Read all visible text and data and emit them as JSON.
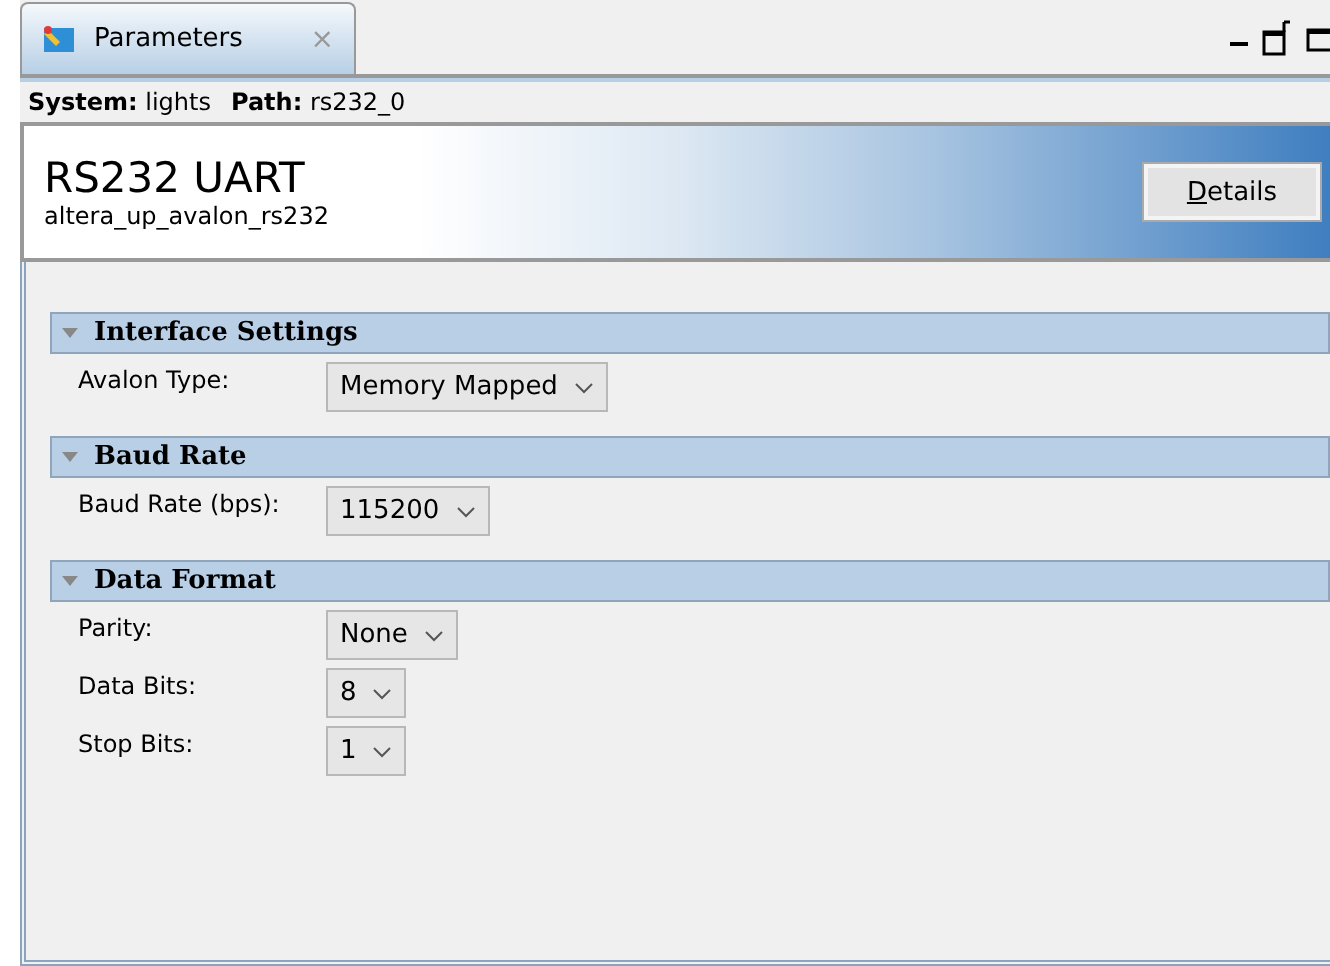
{
  "tab": {
    "title": "Parameters",
    "close": "⨯"
  },
  "path_bar": {
    "system_label": "System:",
    "system": "lights",
    "path_label": "Path:",
    "path": "rs232_0"
  },
  "header": {
    "title": "RS232 UART",
    "subtitle": "altera_up_avalon_rs232",
    "button": "Details"
  },
  "sections": [
    {
      "title": "Interface Settings",
      "expanded": true,
      "rows": [
        {
          "label": "Avalon Type:",
          "value": "Memory Mapped"
        }
      ]
    },
    {
      "title": "Baud Rate",
      "expanded": true,
      "rows": [
        {
          "label": "Baud Rate (bps):",
          "value": "115200"
        }
      ]
    },
    {
      "title": "Data Format",
      "expanded": true,
      "rows": [
        {
          "label": "Parity:",
          "value": "None"
        },
        {
          "label": "Data Bits:",
          "value": "8"
        },
        {
          "label": "Stop Bits:",
          "value": "1"
        }
      ]
    }
  ]
}
